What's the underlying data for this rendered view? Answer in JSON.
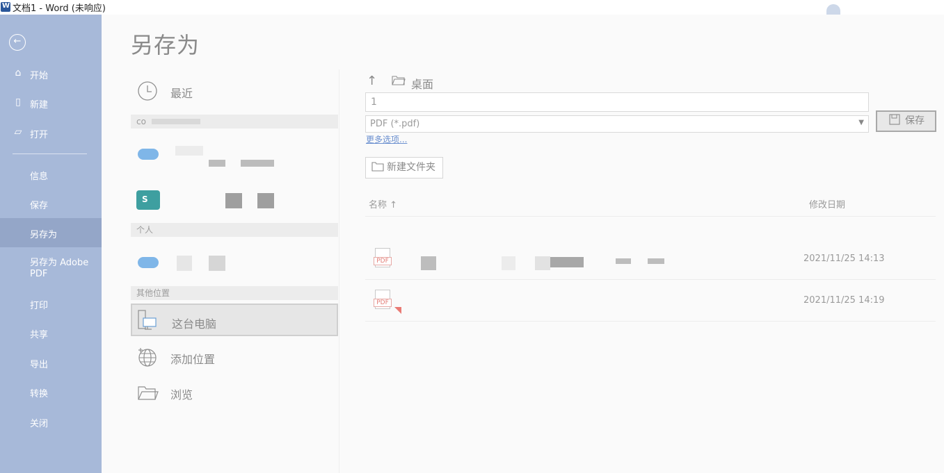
{
  "titlebar": {
    "title": "文档1 - Word (未响应)"
  },
  "nav": {
    "back_icon": "back-arrow-icon",
    "items": [
      {
        "label": "开始",
        "icon": "home-icon"
      },
      {
        "label": "新建",
        "icon": "new-document-icon"
      },
      {
        "label": "打开",
        "icon": "open-folder-icon"
      },
      {
        "label": "信息"
      },
      {
        "label": "保存"
      },
      {
        "label": "另存为",
        "active": true
      },
      {
        "label": "另存为 Adobe PDF"
      },
      {
        "label": "打印"
      },
      {
        "label": "共享"
      },
      {
        "label": "导出"
      },
      {
        "label": "转换"
      },
      {
        "label": "关闭"
      }
    ]
  },
  "page": {
    "title": "另存为"
  },
  "locations": {
    "recent": "最近",
    "group_company": "co",
    "group_personal": "个人",
    "group_other": "其他位置",
    "this_pc": "这台电脑",
    "add_place": "添加位置",
    "browse": "浏览"
  },
  "save_panel": {
    "up_icon": "up-arrow-icon",
    "folder_icon": "folder-icon",
    "path": "桌面",
    "filename": "1",
    "filetype": "PDF (*.pdf)",
    "more_options": "更多选项...",
    "save_button": "保存",
    "new_folder": "新建文件夹",
    "col_name": "名称 ↑",
    "col_date": "修改日期"
  },
  "files": [
    {
      "type_tag": "PDF",
      "modified": "2021/11/25 14:13"
    },
    {
      "type_tag": "PDF",
      "modified": "2021/11/25 14:19"
    }
  ],
  "colors": {
    "nav_bg": "#a7b9d9",
    "nav_active": "#94a6c8",
    "link": "#6a8fcf"
  }
}
